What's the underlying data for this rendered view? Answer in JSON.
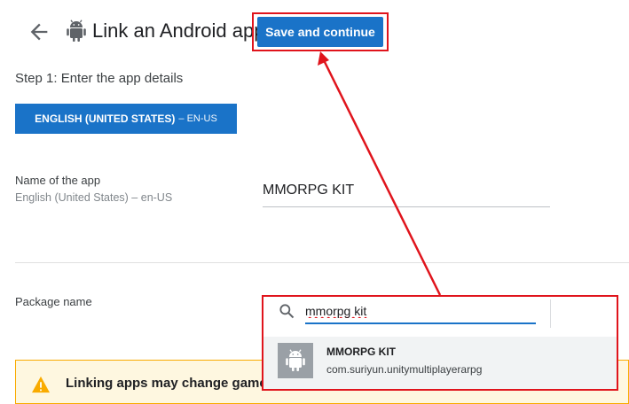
{
  "header": {
    "title": "Link an Android app",
    "back_icon": "arrow-back-icon",
    "app_icon": "android-icon"
  },
  "toolbar": {
    "save_label": "Save and continue"
  },
  "step": {
    "label": "Step 1: Enter the app details"
  },
  "language_chip": {
    "label": "ENGLISH (UNITED STATES)",
    "code": "– EN-US"
  },
  "app_name": {
    "label": "Name of the app",
    "sublabel": "English (United States) – en-US",
    "value": "MMORPG KIT"
  },
  "package": {
    "label": "Package name"
  },
  "search": {
    "value": "mmorpg kit",
    "icon": "search-icon"
  },
  "result": {
    "title": "MMORPG KIT",
    "package_name": "com.suriyun.unitymultiplayerarpg",
    "icon": "android-icon"
  },
  "warning": {
    "text": "Linking apps may change game",
    "icon": "warning-icon"
  },
  "colors": {
    "primary": "#1a73c8",
    "highlight": "#e0141c",
    "warning_bg": "#fef7e0",
    "warning_border": "#f9ab00"
  }
}
